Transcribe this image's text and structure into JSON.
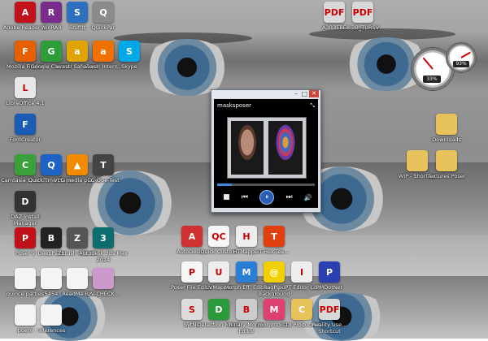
{
  "desktop": {
    "icons": [
      {
        "id": "adobe",
        "label": "Adobe Reader XI",
        "glyph": "A",
        "color": "#c1121c"
      },
      {
        "id": "winrar",
        "label": "WinRAR",
        "glyph": "R",
        "color": "#7a2c8c"
      },
      {
        "id": "stuffit",
        "label": "StuffIt",
        "glyph": "S",
        "color": "#2e6fbf"
      },
      {
        "id": "quickpar",
        "label": "QuickPar",
        "glyph": "Q",
        "color": "#8b8b8b"
      },
      {
        "id": "firefox",
        "label": "Mozilla Firefox",
        "glyph": "F",
        "color": "#e66000"
      },
      {
        "id": "chrome",
        "label": "Google Chrome",
        "glyph": "G",
        "color": "#2f9c3a"
      },
      {
        "id": "avast-safezone",
        "label": "avast! SafeZone",
        "glyph": "a",
        "color": "#e0a400"
      },
      {
        "id": "avast",
        "label": "avast! Intern...",
        "glyph": "a",
        "color": "#f07000"
      },
      {
        "id": "skype",
        "label": "Skype",
        "glyph": "S",
        "color": "#00a8e8"
      },
      {
        "id": "libreoffice",
        "label": "LibreOffice 4.1",
        "glyph": "L",
        "color": "#e8e8e8"
      },
      {
        "id": "fontcreator",
        "label": "FontCreator",
        "glyph": "F",
        "color": "#1a5cb3"
      },
      {
        "id": "camtasia",
        "label": "Camtasia Studio 5",
        "glyph": "C",
        "color": "#3aa13a"
      },
      {
        "id": "quicktime",
        "label": "QuickTime Player",
        "glyph": "Q",
        "color": "#1c63c4"
      },
      {
        "id": "vlc",
        "label": "VLC media player",
        "glyph": "▲",
        "color": "#f28a00"
      },
      {
        "id": "ccleaner",
        "label": "CC-Ope-Test",
        "glyph": "T",
        "color": "#444"
      },
      {
        "id": "daz",
        "label": "DAZ Install Manager",
        "glyph": "D",
        "color": "#333"
      },
      {
        "id": "poser",
        "label": "Poser 9",
        "glyph": "P",
        "color": "#c0101a"
      },
      {
        "id": "blender",
        "label": "DeepPaint",
        "glyph": "B",
        "color": "#222"
      },
      {
        "id": "zbrush",
        "label": "Zbrush 4R6 64",
        "glyph": "Z",
        "color": "#555"
      },
      {
        "id": "3dsmax",
        "label": "Autodesk 3ds Max 2014",
        "glyph": "3",
        "color": "#0b6d6d"
      },
      {
        "id": "quince",
        "label": "quince patties",
        "glyph": "",
        "color": "#f4f4f4"
      },
      {
        "id": "n5454",
        "label": "5454",
        "glyph": "",
        "color": "#f4f4f4"
      },
      {
        "id": "readme",
        "label": "ReadMe-BR",
        "glyph": "",
        "color": "#f4f4f4"
      },
      {
        "id": "uvcheck",
        "label": "UV-CHECK...",
        "glyph": "",
        "color": "#c9c"
      },
      {
        "id": "poem",
        "label": "poem",
        "glyph": "",
        "color": "#f4f4f4"
      },
      {
        "id": "references",
        "label": "references",
        "glyph": "",
        "color": "#f4f4f4"
      },
      {
        "id": "pdf1",
        "label": "A3B3EBE",
        "glyph": "PDF",
        "color": "#d9d9d9"
      },
      {
        "id": "pdf2",
        "label": "8-3B_TURSV",
        "glyph": "PDF",
        "color": "#d9d9d9"
      },
      {
        "id": "downloads",
        "label": "Downloads",
        "glyph": "",
        "color": "#e8c25a"
      },
      {
        "id": "wip",
        "label": "WIP - Shortcut",
        "glyph": "",
        "color": "#e8c25a"
      },
      {
        "id": "textures",
        "label": "Textures Poser",
        "glyph": "",
        "color": "#e8c25a"
      },
      {
        "id": "autocad",
        "label": "AutoDesk...",
        "glyph": "A",
        "color": "#d03030"
      },
      {
        "id": "qc",
        "label": "Quick Custom",
        "glyph": "QC",
        "color": "#f6f6f6"
      },
      {
        "id": "htmapper",
        "label": "HTMapper",
        "glyph": "H",
        "color": "#eee"
      },
      {
        "id": "ttttt",
        "label": "T-Hex-Tee...",
        "glyph": "T",
        "color": "#e04010"
      },
      {
        "id": "poserfile",
        "label": "Poser File Editor",
        "glyph": "P",
        "color": "#f6f6f6"
      },
      {
        "id": "uvmap",
        "label": "UVMapper",
        "glyph": "U",
        "color": "#eee"
      },
      {
        "id": "morph",
        "label": "Morph Eff. Editor",
        "glyph": "M",
        "color": "#2a7fd4"
      },
      {
        "id": "bagpipe",
        "label": "BagPipe Background",
        "glyph": "@",
        "color": "#f0d000"
      },
      {
        "id": "ipt",
        "label": "IPT Editor Lite",
        "glyph": "I",
        "color": "#eee"
      },
      {
        "id": "pmdotnet",
        "label": "PMDotNet",
        "glyph": "P",
        "color": "#2a40b0"
      },
      {
        "id": "syntu",
        "label": "SytNU",
        "glyph": "S",
        "color": "#ddd"
      },
      {
        "id": "detection",
        "label": "Detection Magic",
        "glyph": "D",
        "color": "#2a9a3a"
      },
      {
        "id": "binary",
        "label": "Binary Morph Editor",
        "glyph": "B",
        "color": "#ccc"
      },
      {
        "id": "morphtool",
        "label": "morphtool...",
        "glyph": "M",
        "color": "#e04070"
      },
      {
        "id": "cdi",
        "label": "CDI Production",
        "glyph": "C",
        "color": "#e8c25a"
      },
      {
        "id": "reality",
        "label": "Reality Use... Shortcut",
        "glyph": "PDF",
        "color": "#d9d9d9"
      }
    ]
  },
  "player": {
    "title": "masksposer",
    "progress": 0.15,
    "controls": {
      "prev": "⏮",
      "play": "⏸",
      "next": "⏭",
      "stop": "■",
      "volume": "🔊"
    }
  },
  "gauges": [
    {
      "label": "33%",
      "value": 0.33
    },
    {
      "label": "93%",
      "value": 0.93
    }
  ]
}
